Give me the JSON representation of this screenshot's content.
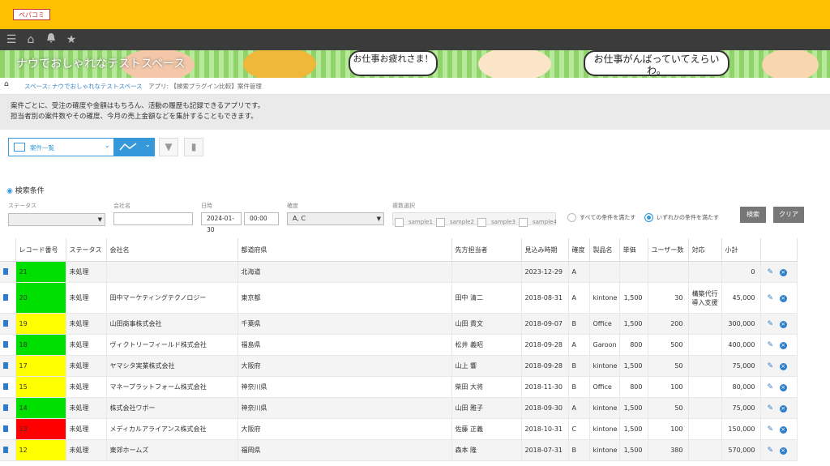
{
  "app": {
    "logo_text": "ペパコミ"
  },
  "banner": {
    "title": "ナウでおしゃれなテストスペース",
    "bubble1": "お仕事お疲れさま！",
    "bubble2": "お仕事がんばっていてえらいわ。"
  },
  "breadcrumb": {
    "space": "スペース: ナウでおしゃれなテストスペース",
    "app": "アプリ: 【検索プラグイン比較】案件管理"
  },
  "description": {
    "line1": "案件ごとに、受注の確度や金額はもちろん、活動の履歴も記録できるアプリです。",
    "line2": "担当者別の案件数やその確度、今月の売上金額などを集計することもできます。"
  },
  "toolbar": {
    "view_label": "案件一覧"
  },
  "search": {
    "header": "検索条件",
    "status_label": "ステータス",
    "status_value": "",
    "company_label": "会社名",
    "company_value": "",
    "date_label": "日時",
    "date_value": "2024-01-30",
    "time_value": "00:00",
    "certainty_label": "確度",
    "certainty_value": "A, C",
    "multi_label": "複数選択",
    "samples": [
      "sample1",
      "sample2",
      "sample3",
      "sample4"
    ],
    "radio_all": "すべての条件を満たす",
    "radio_any": "いずれかの条件を満たす",
    "search_button": "検索",
    "clear_button": "クリア"
  },
  "table": {
    "headers": [
      "レコード番号",
      "ステータス",
      "会社名",
      "都道府県",
      "先方担当者",
      "見込み時期",
      "確度",
      "製品名",
      "単価",
      "ユーザー数",
      "対応",
      "小計"
    ],
    "rows": [
      {
        "id": "21",
        "status": "未処理",
        "company": "",
        "pref": "北海道",
        "contact": "",
        "date": "2023-12-29",
        "cert": "A",
        "product": "",
        "price": "",
        "users": "",
        "resp": "",
        "subtotal": "0",
        "color": "#00e000"
      },
      {
        "id": "20",
        "status": "未処理",
        "company": "田中マーケティングテクノロジー",
        "pref": "東京都",
        "contact": "田中 清二",
        "date": "2018-08-31",
        "cert": "A",
        "product": "kintone",
        "price": "1,500",
        "users": "30",
        "resp": "構築代行 導入支援",
        "subtotal": "45,000",
        "color": "#00e000"
      },
      {
        "id": "19",
        "status": "未処理",
        "company": "山田商事株式会社",
        "pref": "千葉県",
        "contact": "山田 貴文",
        "date": "2018-09-07",
        "cert": "B",
        "product": "Office",
        "price": "1,500",
        "users": "200",
        "resp": "",
        "subtotal": "300,000",
        "color": "#ffff00"
      },
      {
        "id": "18",
        "status": "未処理",
        "company": "ヴィクトリーフィールド株式会社",
        "pref": "福島県",
        "contact": "松井 義昭",
        "date": "2018-09-28",
        "cert": "A",
        "product": "Garoon",
        "price": "800",
        "users": "500",
        "resp": "",
        "subtotal": "400,000",
        "color": "#00e000"
      },
      {
        "id": "17",
        "status": "未処理",
        "company": "ヤマシタ実業株式会社",
        "pref": "大阪府",
        "contact": "山上 響",
        "date": "2018-09-28",
        "cert": "B",
        "product": "kintone",
        "price": "1,500",
        "users": "50",
        "resp": "",
        "subtotal": "75,000",
        "color": "#ffff00"
      },
      {
        "id": "15",
        "status": "未処理",
        "company": "マネープラットフォーム株式会社",
        "pref": "神奈川県",
        "contact": "柴田 大将",
        "date": "2018-11-30",
        "cert": "B",
        "product": "Office",
        "price": "800",
        "users": "100",
        "resp": "",
        "subtotal": "80,000",
        "color": "#ffff00"
      },
      {
        "id": "14",
        "status": "未処理",
        "company": "株式会社ワボー",
        "pref": "神奈川県",
        "contact": "山田 雅子",
        "date": "2018-09-30",
        "cert": "A",
        "product": "kintone",
        "price": "1,500",
        "users": "50",
        "resp": "",
        "subtotal": "75,000",
        "color": "#00e000"
      },
      {
        "id": "13",
        "status": "未処理",
        "company": "メディカルアライアンス株式会社",
        "pref": "大阪府",
        "contact": "佐藤 正義",
        "date": "2018-10-31",
        "cert": "C",
        "product": "kintone",
        "price": "1,500",
        "users": "100",
        "resp": "",
        "subtotal": "150,000",
        "color": "#ff0000"
      },
      {
        "id": "12",
        "status": "未処理",
        "company": "東郊ホームズ",
        "pref": "福岡県",
        "contact": "森本 隆",
        "date": "2018-07-31",
        "cert": "B",
        "product": "kintone",
        "price": "1,500",
        "users": "380",
        "resp": "",
        "subtotal": "570,000",
        "color": "#ffff00"
      }
    ]
  }
}
